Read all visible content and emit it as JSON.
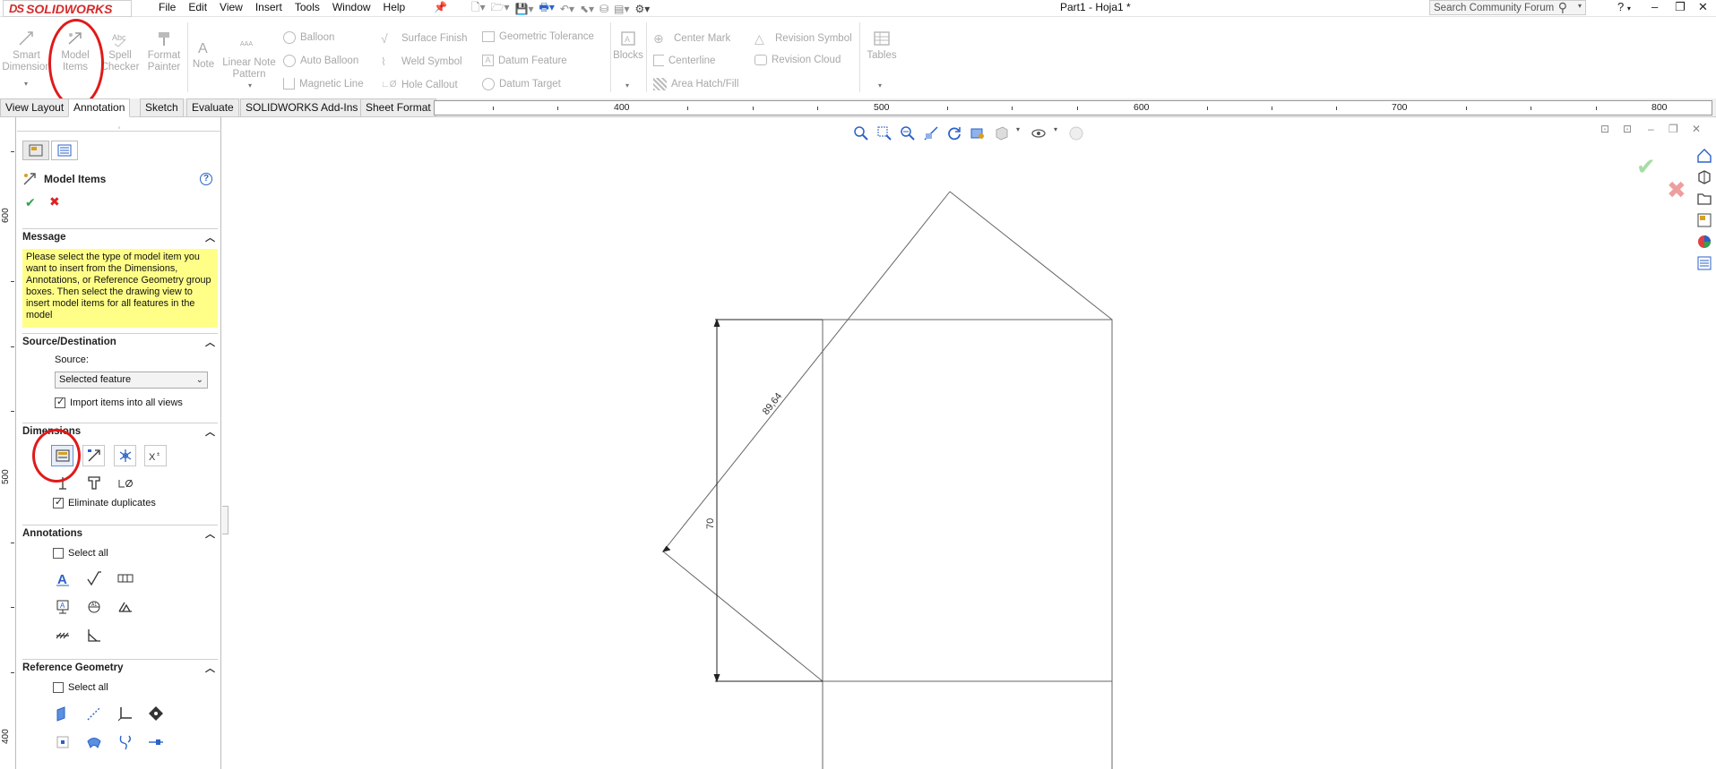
{
  "app": {
    "brand": "SOLIDWORKS",
    "brand_prefix": "DS",
    "document_title": "Part1 - Hoja1 *"
  },
  "menu": [
    "File",
    "Edit",
    "View",
    "Insert",
    "Tools",
    "Window",
    "Help"
  ],
  "search": {
    "placeholder": "Search Community Forum"
  },
  "window_controls": {
    "help": "?",
    "minimize": "–",
    "restore": "❐",
    "close": "✕"
  },
  "command_manager": {
    "smart_dimension": "Smart Dimension",
    "model_items": "Model Items",
    "spell_checker": "Spell Checker",
    "format_painter": "Format Painter",
    "note": "Note",
    "linear_note_pattern": "Linear Note Pattern",
    "balloon": "Balloon",
    "auto_balloon": "Auto Balloon",
    "magnetic_line": "Magnetic Line",
    "surface_finish": "Surface Finish",
    "weld_symbol": "Weld Symbol",
    "hole_callout": "Hole Callout",
    "geometric_tolerance": "Geometric Tolerance",
    "datum_feature": "Datum Feature",
    "datum_target": "Datum Target",
    "blocks": "Blocks",
    "center_mark": "Center Mark",
    "centerline": "Centerline",
    "area_hatch": "Area Hatch/Fill",
    "revision_symbol": "Revision Symbol",
    "revision_cloud": "Revision Cloud",
    "tables": "Tables"
  },
  "tabs": [
    "View Layout",
    "Annotation",
    "Sketch",
    "Evaluate",
    "SOLIDWORKS Add-Ins",
    "Sheet Format"
  ],
  "active_tab": "Annotation",
  "ruler_top": [
    "400",
    "500",
    "600",
    "700",
    "800"
  ],
  "ruler_left": [
    "600",
    "500",
    "400"
  ],
  "property_manager": {
    "title": "Model Items",
    "message_header": "Message",
    "message": "Please select the type of model item you want to insert from the Dimensions, Annotations, or Reference Geometry group boxes. Then select the drawing view  to insert model items for all features in the model",
    "source_dest_header": "Source/Destination",
    "source_label": "Source:",
    "source_value": "Selected feature",
    "import_all_views": "Import items into all views",
    "import_all_views_checked": true,
    "dimensions_header": "Dimensions",
    "eliminate_duplicates": "Eliminate duplicates",
    "eliminate_duplicates_checked": true,
    "annotations_header": "Annotations",
    "annotations_select_all": "Select all",
    "annotations_select_all_checked": false,
    "ref_geometry_header": "Reference Geometry",
    "ref_geometry_select_all": "Select all",
    "ref_geometry_select_all_checked": false
  },
  "drawing": {
    "dim_diagonal": "89,64",
    "dim_vertical": "70"
  },
  "colors": {
    "accent": "#2a62c8",
    "highlight_circle": "#e01a1a",
    "message_bg": "#ffff88",
    "brand_red": "#d42a2a"
  }
}
